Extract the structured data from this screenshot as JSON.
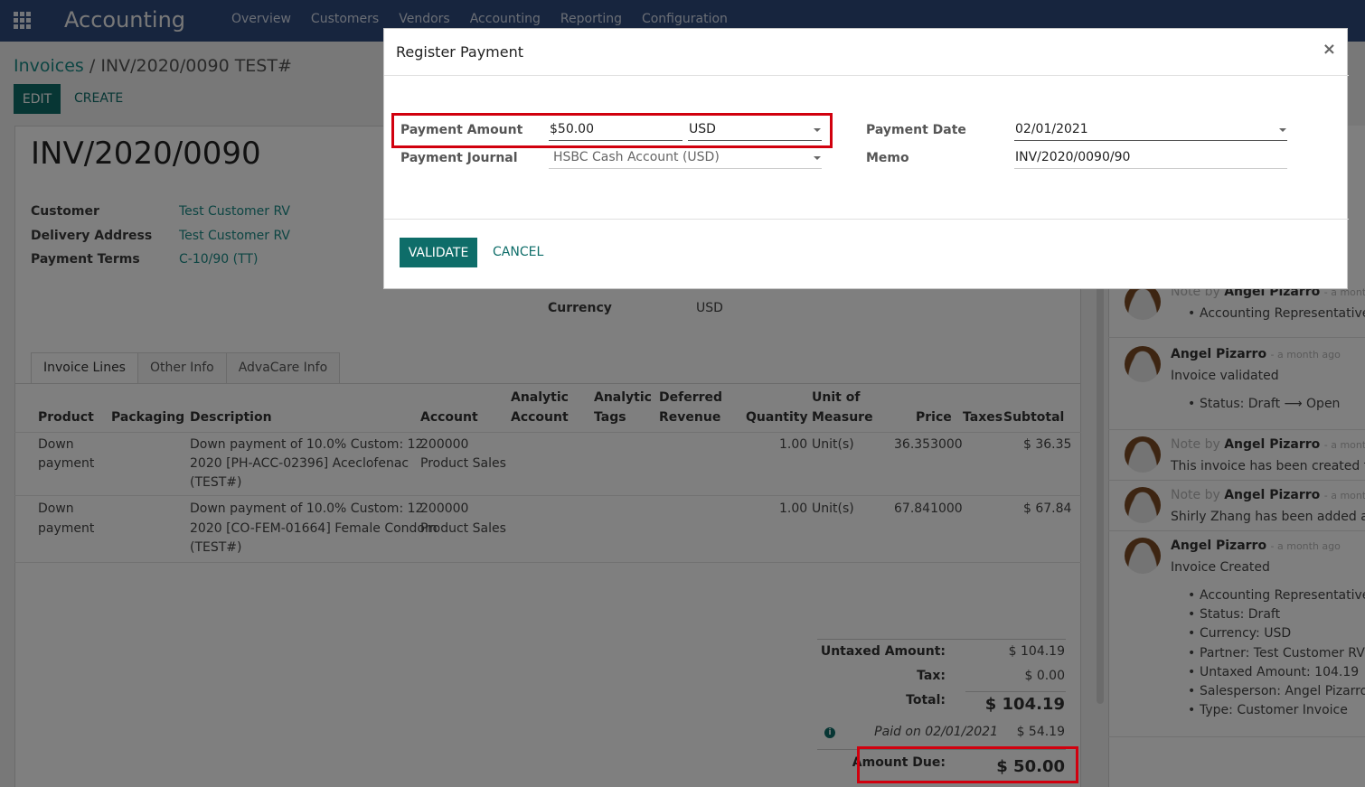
{
  "nav": {
    "app_title": "Accounting",
    "menu": [
      "Overview",
      "Customers",
      "Vendors",
      "Accounting",
      "Reporting",
      "Configuration"
    ]
  },
  "breadcrumb": {
    "parent": "Invoices",
    "separator": "/",
    "current": "INV/2020/0090 TEST#"
  },
  "buttons": {
    "edit": "EDIT",
    "create": "CREATE"
  },
  "invoice": {
    "number": "INV/2020/0090",
    "customer_label": "Customer",
    "customer": "Test Customer RV",
    "delivery_label": "Delivery Address",
    "delivery": "Test Customer RV",
    "terms_label": "Payment Terms",
    "terms": "C-10/90 (TT)",
    "currency_label": "Currency",
    "currency": "USD"
  },
  "tabs": [
    "Invoice Lines",
    "Other Info",
    "AdvaCare Info"
  ],
  "lines": {
    "headers": {
      "product": "Product",
      "packaging": "Packaging",
      "description": "Description",
      "account": "Account",
      "analytic_account_1": "Analytic",
      "analytic_account_2": "Account",
      "analytic_tags_1": "Analytic",
      "analytic_tags_2": "Tags",
      "deferred_1": "Deferred",
      "deferred_2": "Revenue",
      "quantity": "Quantity",
      "uom_1": "Unit of",
      "uom_2": "Measure",
      "price": "Price",
      "taxes": "Taxes",
      "subtotal": "Subtotal"
    },
    "rows": [
      {
        "product_1": "Down",
        "product_2": "payment",
        "desc_1": "Down payment of 10.0% Custom: 12",
        "desc_2": "2020 [PH-ACC-02396] Aceclofenac",
        "desc_3": "(TEST#)",
        "account_1": "200000",
        "account_2": "Product Sales",
        "quantity": "1.00",
        "uom": "Unit(s)",
        "price": "36.353000",
        "subtotal": "$ 36.35"
      },
      {
        "product_1": "Down",
        "product_2": "payment",
        "desc_1": "Down payment of 10.0% Custom: 12",
        "desc_2": "2020 [CO-FEM-01664] Female Condom",
        "desc_3": "(TEST#)",
        "account_1": "200000",
        "account_2": "Product Sales",
        "quantity": "1.00",
        "uom": "Unit(s)",
        "price": "67.841000",
        "subtotal": "$ 67.84"
      }
    ]
  },
  "totals": {
    "untaxed_label": "Untaxed Amount:",
    "untaxed": "$ 104.19",
    "tax_label": "Tax:",
    "tax": "$ 0.00",
    "total_label": "Total:",
    "total": "$ 104.19",
    "paid_label": "Paid on 02/01/2021",
    "paid": "$ 54.19",
    "due_label": "Amount Due:",
    "due": "$ 50.00"
  },
  "chatter": {
    "messages": [
      {
        "note": "Note by",
        "author": "Angel Pizarro",
        "time": "- a month ago",
        "bullets": [
          "Accounting Representative:"
        ]
      },
      {
        "note": "",
        "author": "Angel Pizarro",
        "time": "- a month ago",
        "body": "Invoice validated",
        "bullets": [
          "Status: Draft ⟶ Open"
        ]
      },
      {
        "note": "Note by",
        "author": "Angel Pizarro",
        "time": "- a month ago",
        "body": "This invoice has been created from"
      },
      {
        "note": "Note by",
        "author": "Angel Pizarro",
        "time": "- a month ago",
        "body": "Shirly Zhang has been added as a"
      },
      {
        "note": "",
        "author": "Angel Pizarro",
        "time": "- a month ago",
        "body": "Invoice Created",
        "bullets": [
          "Accounting Representative:",
          "Status: Draft",
          "Currency: USD",
          "Partner: Test Customer RV",
          "Untaxed Amount: 104.19",
          "Salesperson: Angel Pizarro",
          "Type: Customer Invoice"
        ]
      }
    ]
  },
  "modal": {
    "title": "Register Payment",
    "close": "×",
    "amount_label": "Payment Amount",
    "amount_symbol": "$",
    "amount_value": "50.00",
    "currency_value": "USD",
    "journal_label": "Payment Journal",
    "journal_value": "HSBC Cash Account (USD)",
    "date_label": "Payment Date",
    "date_value": "02/01/2021",
    "memo_label": "Memo",
    "memo_value": "INV/2020/0090/90",
    "validate": "VALIDATE",
    "cancel": "CANCEL"
  },
  "colors": {
    "nav": "#2f4a7d",
    "primary": "#0e6d69",
    "link": "#1b8a86",
    "highlight": "#d1000e"
  }
}
